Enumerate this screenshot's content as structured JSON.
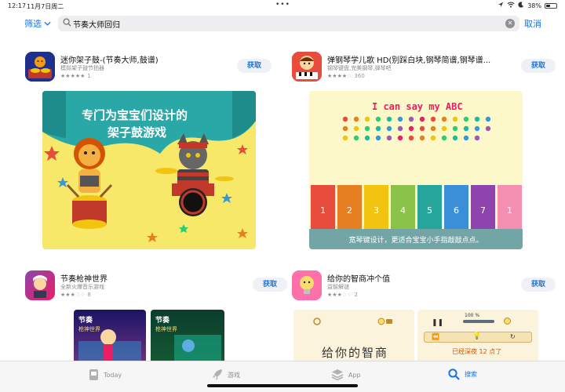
{
  "status": {
    "time": "12:17",
    "date": "11月7日周二",
    "battery": "38%",
    "battery_level": 0.38
  },
  "search": {
    "filter_label": "筛选",
    "query": "节奏大师回归",
    "cancel_label": "取消"
  },
  "apps": [
    {
      "name": "迷你架子鼓-(节奏大师,鼓谱)",
      "subtitle": "模拟架子鼓节拍器",
      "rating_stars": 5,
      "rating_count": "1",
      "get_label": "获取",
      "screenshot": {
        "headline_1": "专门为宝宝们设计的",
        "headline_2": "架子鼓游戏"
      }
    },
    {
      "name": "弹钢琴学儿歌 HD(别踩白块,钢琴简谱,钢琴谱...",
      "subtitle": "钢琴键盘,完美钢琴,弹琴吧",
      "rating_stars": 4,
      "rating_count": "360",
      "get_label": "获取",
      "screenshot": {
        "title": "I can say my ABC",
        "keys": [
          "1",
          "2",
          "3",
          "4",
          "5",
          "6",
          "7",
          "1"
        ],
        "caption": "宽琴键设计，更适合宝宝小手指敲敲点点。"
      }
    },
    {
      "name": "节奏枪神世界",
      "subtitle": "全新火爆音乐游戏",
      "rating_stars": 3,
      "rating_count": "8",
      "get_label": "获取"
    },
    {
      "name": "给你的智商冲个值",
      "subtitle": "益智解谜",
      "rating_stars": 3,
      "rating_count": "2",
      "get_label": "获取",
      "screenshot": {
        "percent": "100 %",
        "hint": "已经深夜 12 点了",
        "headline": "给你的智商"
      }
    }
  ],
  "tabs": [
    {
      "label": "Today",
      "icon": "today-icon"
    },
    {
      "label": "游戏",
      "icon": "rocket-icon"
    },
    {
      "label": "App",
      "icon": "apps-stack-icon"
    },
    {
      "label": "搜索",
      "icon": "search-icon"
    }
  ],
  "colors": {
    "accent": "#1a73e8",
    "drum_bg": "#f7e86a",
    "curtain": "#2aa7a7"
  }
}
